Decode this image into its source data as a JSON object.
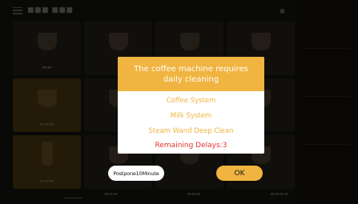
{
  "dialog": {
    "title": "The coffee machine requires daily cleaning",
    "items": [
      "Coffee System",
      "Milk System",
      "Steam Wand Deep Clean"
    ],
    "remaining": "Remaining Delays:3",
    "postpone_label": "Postpone10Minute",
    "ok_label": "OK"
  },
  "colors": {
    "accent": "#f0b440",
    "warning": "#e0322c",
    "dialog_bg": "#ffffff"
  }
}
